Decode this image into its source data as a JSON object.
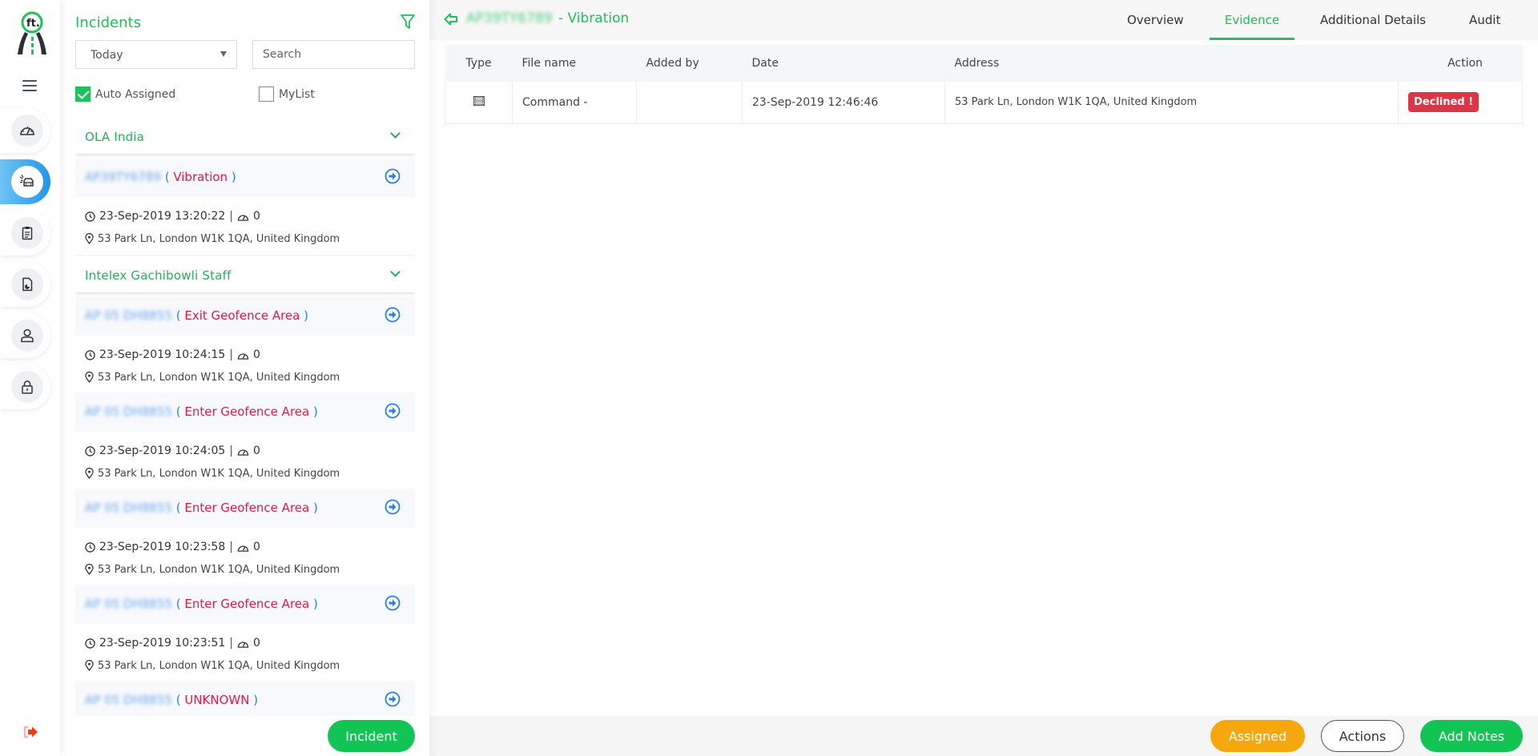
{
  "sidebar": {
    "logo_text": "ft.",
    "nav_items": [
      {
        "name": "dashboard",
        "icon": "speedometer-icon",
        "active": false
      },
      {
        "name": "incidents",
        "icon": "car-crash-icon",
        "active": true
      },
      {
        "name": "reports",
        "icon": "clipboard-icon",
        "active": false
      },
      {
        "name": "documents",
        "icon": "file-chart-icon",
        "active": false
      },
      {
        "name": "users",
        "icon": "user-icon",
        "active": false
      },
      {
        "name": "security",
        "icon": "lock-icon",
        "active": false
      }
    ],
    "logout_icon": "sign-out-icon"
  },
  "left_panel": {
    "title": "Incidents",
    "date_filter": "Today",
    "search_placeholder": "Search",
    "auto_assigned_label": "Auto Assigned",
    "auto_assigned_checked": true,
    "mylist_label": "MyList",
    "mylist_checked": false,
    "groups": [
      {
        "name": "OLA India",
        "incidents": [
          {
            "vehicle_id": "AP39TY6789",
            "type": "Vibration",
            "datetime": "23-Sep-2019 13:20:22",
            "speed": "0",
            "address": "53 Park Ln, London W1K 1QA, United Kingdom"
          }
        ]
      },
      {
        "name": "Intelex Gachibowli Staff",
        "incidents": [
          {
            "vehicle_id": "AP 05 DH8855",
            "type": "Exit Geofence Area",
            "datetime": "23-Sep-2019 10:24:15",
            "speed": "0",
            "address": "53 Park Ln, London W1K 1QA, United Kingdom"
          },
          {
            "vehicle_id": "AP 05 DH8855",
            "type": "Enter Geofence Area",
            "datetime": "23-Sep-2019 10:24:05",
            "speed": "0",
            "address": "53 Park Ln, London W1K 1QA, United Kingdom"
          },
          {
            "vehicle_id": "AP 05 DH8855",
            "type": "Enter Geofence Area",
            "datetime": "23-Sep-2019 10:23:58",
            "speed": "0",
            "address": "53 Park Ln, London W1K 1QA, United Kingdom"
          },
          {
            "vehicle_id": "AP 05 DH8855",
            "type": "Enter Geofence Area",
            "datetime": "23-Sep-2019 10:23:51",
            "speed": "0",
            "address": "53 Park Ln, London W1K 1QA, United Kingdom"
          },
          {
            "vehicle_id": "AP 05 DH8855",
            "type": "UNKNOWN",
            "datetime": "",
            "speed": "",
            "address": ""
          }
        ]
      }
    ],
    "incident_button": "Incident"
  },
  "main": {
    "title_vehicle_id": "AP39TY6789",
    "title_suffix": "- Vibration",
    "tabs": [
      {
        "label": "Overview",
        "active": false
      },
      {
        "label": "Evidence",
        "active": true
      },
      {
        "label": "Additional Details",
        "active": false
      },
      {
        "label": "Audit",
        "active": false
      }
    ],
    "evidence_table": {
      "columns": [
        "Type",
        "File name",
        "Added by",
        "Date",
        "Address",
        "Action"
      ],
      "rows": [
        {
          "type_icon": "film-icon",
          "file_name": "Command -",
          "added_by": "",
          "date": "23-Sep-2019 12:46:46",
          "address": "53 Park Ln, London W1K 1QA, United Kingdom",
          "action": "Declined !"
        }
      ]
    },
    "footer": {
      "assigned_label": "Assigned",
      "actions_label": "Actions",
      "add_notes_label": "Add Notes"
    }
  },
  "colors": {
    "brand_green": "#1fc15a",
    "button_green": "#12c454",
    "incident_red": "#e8173f",
    "link_blue": "#2f7fd8",
    "declined_red": "#dc3545",
    "assigned_orange": "#f4a80e",
    "active_nav_blue": "#2196e8"
  }
}
